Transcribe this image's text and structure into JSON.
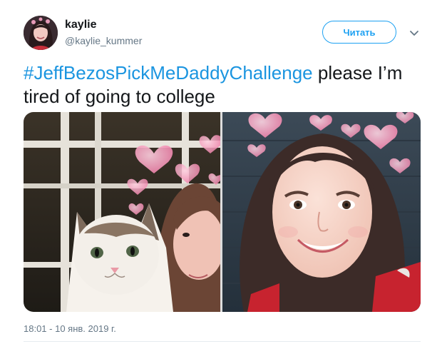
{
  "user": {
    "display_name": "kaylie",
    "handle": "@kaylie_kummer"
  },
  "actions": {
    "follow_label": "Читать",
    "more_icon": "chevron-down-icon"
  },
  "tweet": {
    "hashtag": "#JeffBezosPickMeDaddyChallenge",
    "text": " please I’m tired of going to college",
    "timestamp": "18:01 - 10 янв. 2019 г."
  },
  "colors": {
    "accent": "#1da1f2",
    "hashtag": "#1b95e0",
    "secondary_text": "#657786"
  }
}
